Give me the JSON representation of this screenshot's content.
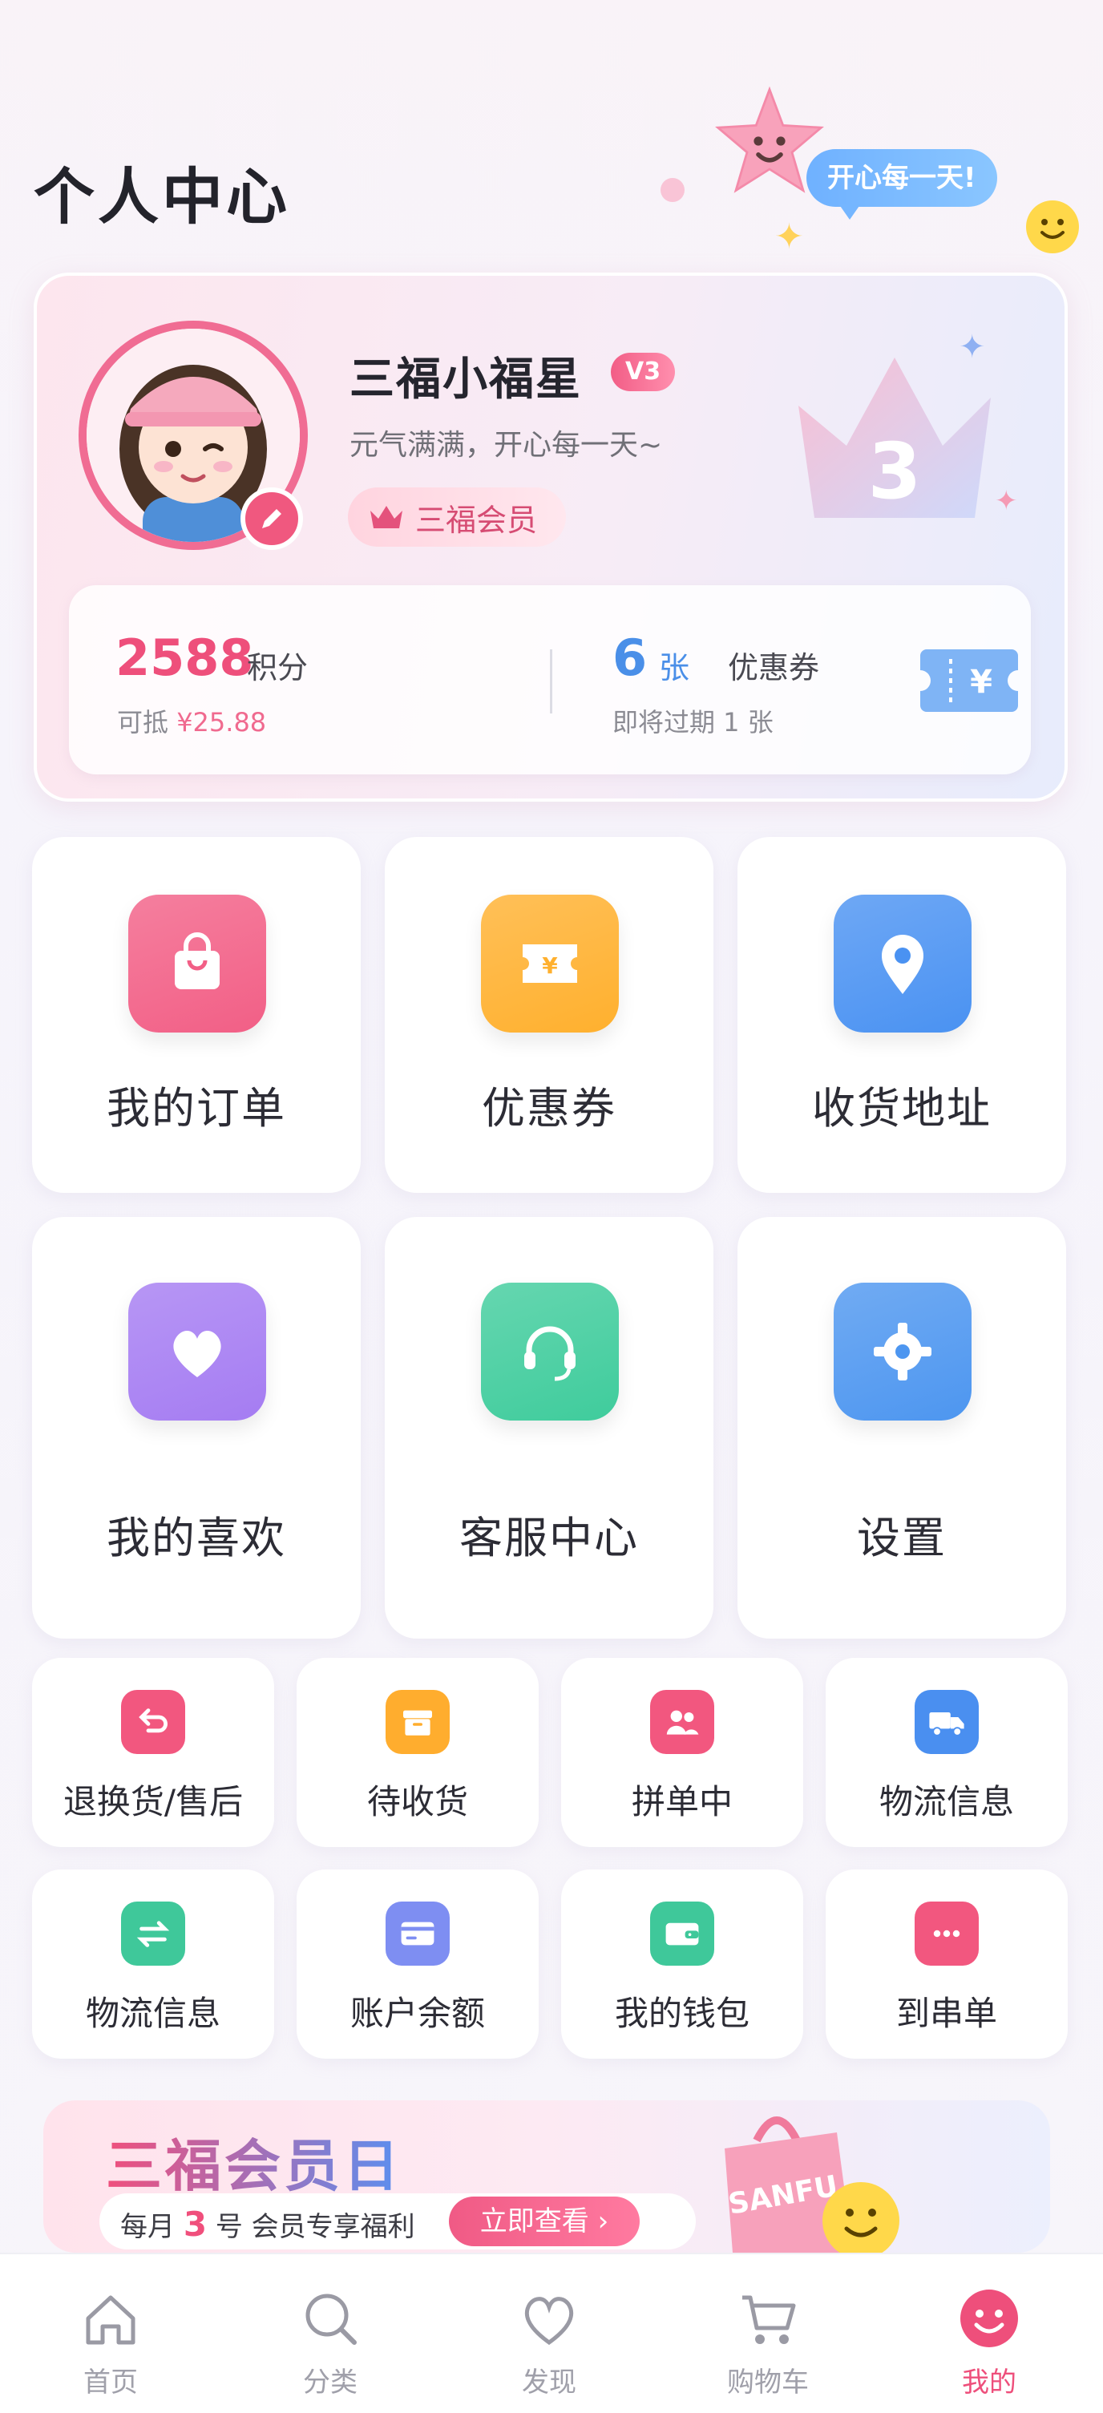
{
  "header": {
    "title": "个人中心",
    "bubble": "开心每一天!"
  },
  "profile": {
    "name": "三福小福星",
    "level": "V3",
    "tagline": "元气满满，开心每一天~",
    "member_label": "三福会员",
    "crown_number": "3",
    "points": {
      "value": "2588",
      "unit": "积分",
      "sub_prefix": "可抵 ",
      "sub_amount": "¥25.88"
    },
    "coupons": {
      "value": "6",
      "unit": "张",
      "label": "优惠券",
      "sub": "即将过期 1 张"
    }
  },
  "big_grid": [
    {
      "label": "我的订单",
      "icon": "bag-icon",
      "color": "#f25f86"
    },
    {
      "label": "优惠券",
      "icon": "coupon-icon",
      "color": "#ffb02e"
    },
    {
      "label": "收货地址",
      "icon": "location-icon",
      "color": "#4a92f2"
    },
    {
      "label": "我的喜欢",
      "icon": "heart-icon",
      "color": "#a57cf2"
    },
    {
      "label": "客服中心",
      "icon": "headset-icon",
      "color": "#3fcc9c"
    },
    {
      "label": "设置",
      "icon": "gear-icon",
      "color": "#4d96f0"
    }
  ],
  "small_grid": [
    {
      "label": "退换货/售后",
      "icon": "return-icon",
      "color": "#f2577f"
    },
    {
      "label": "待收货",
      "icon": "box-icon",
      "color": "#ffad2e"
    },
    {
      "label": "拼单中",
      "icon": "group-icon",
      "color": "#f2577f"
    },
    {
      "label": "物流信息",
      "icon": "truck-icon",
      "color": "#4a8ff0"
    },
    {
      "label": "物流信息",
      "icon": "exchange-icon",
      "color": "#3fc89a"
    },
    {
      "label": "账户余额",
      "icon": "card-icon",
      "color": "#7e8ef2"
    },
    {
      "label": "我的钱包",
      "icon": "wallet-icon",
      "color": "#3fc89a"
    },
    {
      "label": "到串单",
      "icon": "more-icon",
      "color": "#f2577f"
    }
  ],
  "banner": {
    "title": "三福会员日",
    "sub_prefix": "每月 ",
    "sub_day": "3",
    "sub_suffix": " 号  会员专享福利",
    "button": "立即查看 ›",
    "bag_text": "SANFU"
  },
  "tabs": [
    {
      "label": "首页",
      "icon": "home-icon",
      "active": false
    },
    {
      "label": "分类",
      "icon": "search-icon",
      "active": false
    },
    {
      "label": "发现",
      "icon": "heart-icon",
      "active": false
    },
    {
      "label": "购物车",
      "icon": "cart-icon",
      "active": false
    },
    {
      "label": "我的",
      "icon": "smile-icon",
      "active": true
    }
  ],
  "colors": {
    "accent": "#ee4f7b",
    "blue": "#4a8fe8"
  }
}
